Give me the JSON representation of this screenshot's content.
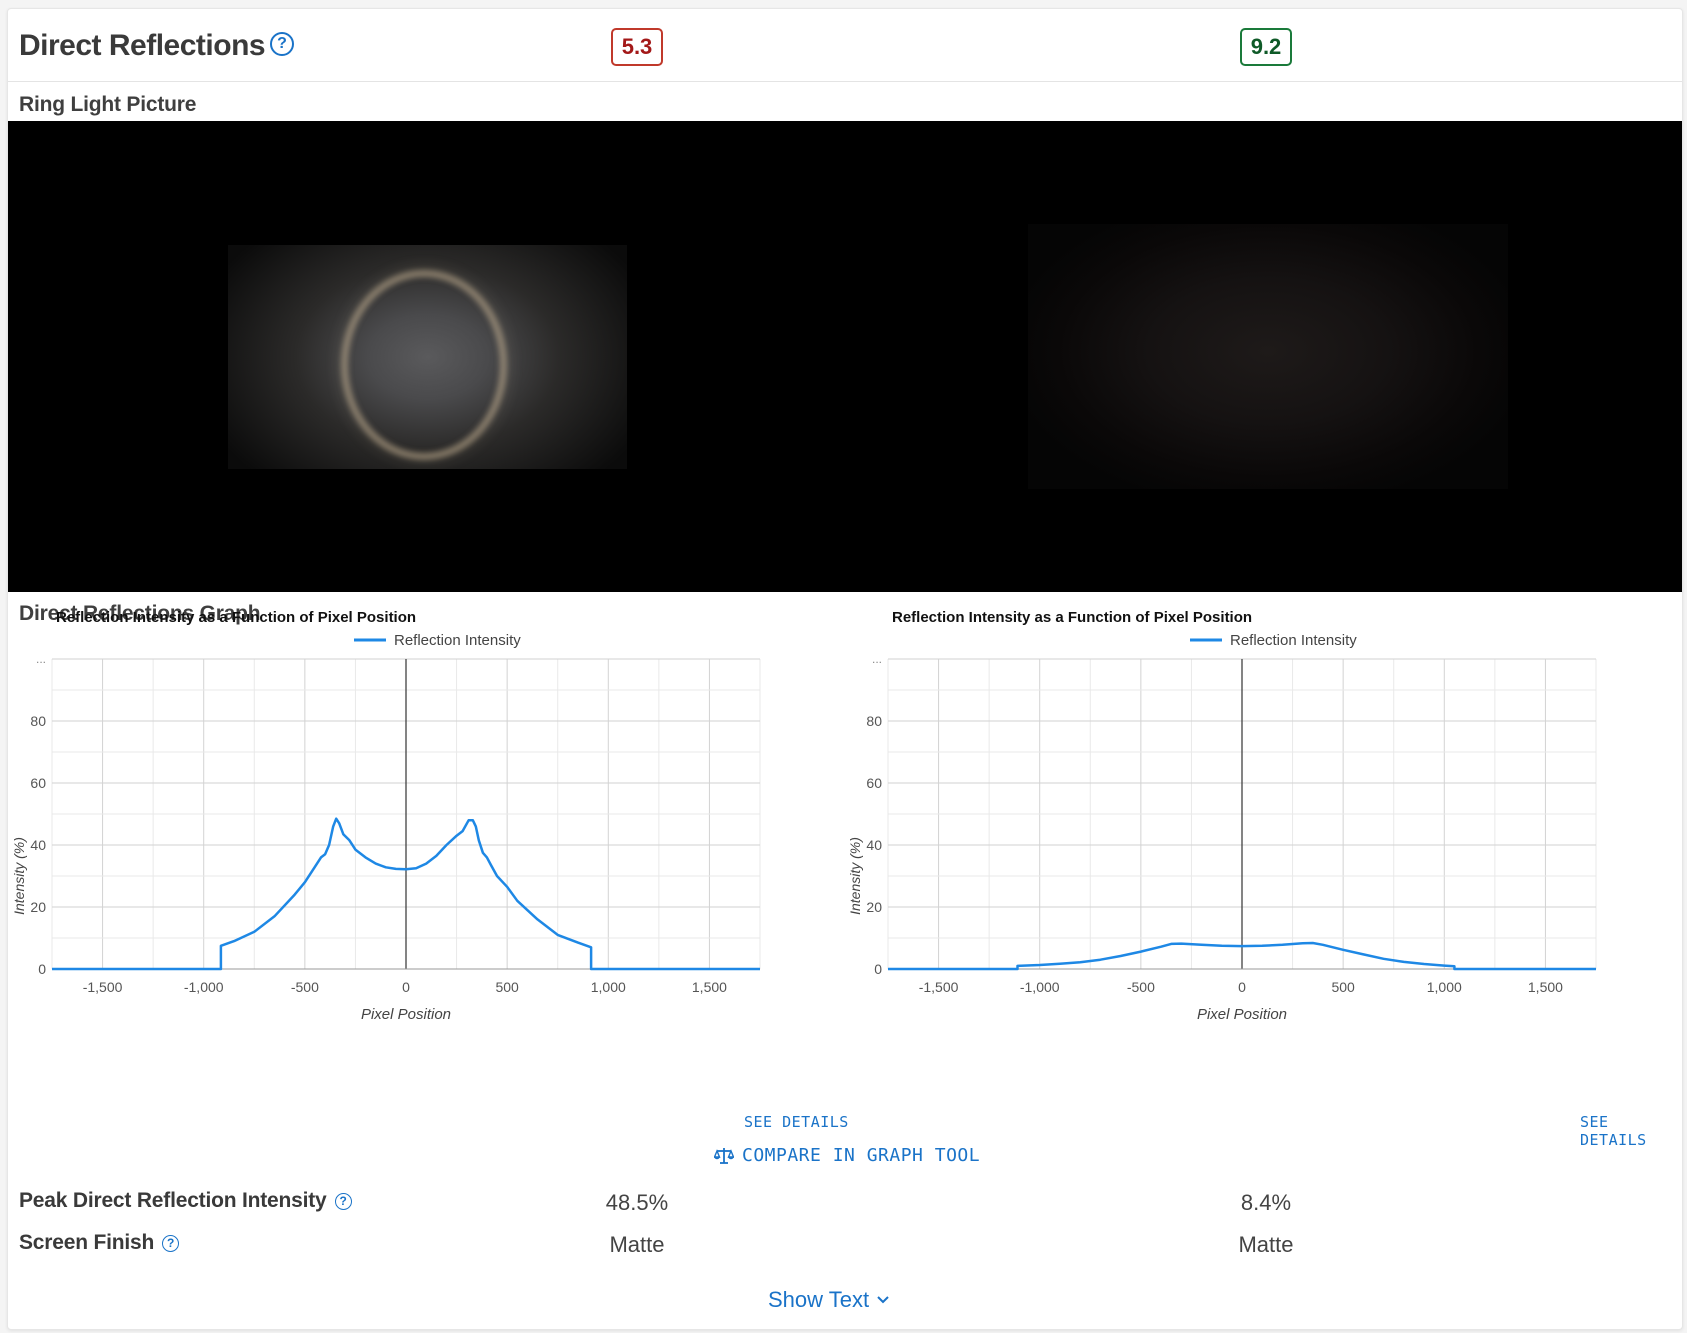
{
  "header": {
    "title": "Direct Reflections",
    "score_left": "5.3",
    "score_right": "9.2"
  },
  "sections": {
    "ring_light": "Ring Light Picture",
    "graph": "Direct Reflections Graph"
  },
  "help_glyph": "?",
  "colors": {
    "accent": "#1a73c8",
    "line": "#1e88e5",
    "score_bad": "#a31818",
    "score_good": "#0f5a28"
  },
  "chart_data": [
    {
      "type": "line",
      "title": "Reflection Intensity as a Function of Pixel Position",
      "xlabel": "Pixel Position",
      "ylabel": "Intensity (%)",
      "xlim": [
        -1750,
        1750
      ],
      "ylim": [
        0,
        100
      ],
      "x_ticks": [
        -1500,
        -1000,
        -500,
        0,
        500,
        1000,
        1500
      ],
      "x_tick_labels": [
        "-1,500",
        "-1,000",
        "-500",
        "0",
        "500",
        "1,000",
        "1,500"
      ],
      "y_ticks": [
        0,
        20,
        40,
        60,
        80
      ],
      "y_tick_labels": [
        "0",
        "20",
        "40",
        "60",
        "80"
      ],
      "y_top_label": "...",
      "grid": true,
      "legend": "top-center",
      "series": [
        {
          "name": "Reflection Intensity",
          "x": [
            -1750,
            -915,
            -915,
            -850,
            -750,
            -650,
            -550,
            -500,
            -450,
            -420,
            -400,
            -380,
            -360,
            -345,
            -330,
            -310,
            -280,
            -250,
            -200,
            -150,
            -100,
            -50,
            0,
            50,
            100,
            150,
            200,
            250,
            280,
            310,
            330,
            345,
            360,
            380,
            400,
            420,
            450,
            500,
            550,
            650,
            750,
            850,
            915,
            915,
            1750
          ],
          "y": [
            0,
            0,
            7.5,
            9,
            12,
            17,
            24,
            28,
            33,
            36,
            37,
            40,
            46,
            48.5,
            47,
            43.5,
            41.5,
            38.5,
            36,
            34,
            32.8,
            32.3,
            32.2,
            32.5,
            34,
            36.5,
            40,
            43,
            44.5,
            48,
            48,
            46,
            41.5,
            37.5,
            36,
            33.5,
            30,
            26.5,
            22,
            16,
            11,
            8.5,
            7,
            0,
            0
          ]
        }
      ]
    },
    {
      "type": "line",
      "title": "Reflection Intensity as a Function of Pixel Position",
      "xlabel": "Pixel Position",
      "ylabel": "Intensity (%)",
      "xlim": [
        -1750,
        1750
      ],
      "ylim": [
        0,
        100
      ],
      "x_ticks": [
        -1500,
        -1000,
        -500,
        0,
        500,
        1000,
        1500
      ],
      "x_tick_labels": [
        "-1,500",
        "-1,000",
        "-500",
        "0",
        "500",
        "1,000",
        "1,500"
      ],
      "y_ticks": [
        0,
        20,
        40,
        60,
        80
      ],
      "y_tick_labels": [
        "0",
        "20",
        "40",
        "60",
        "80"
      ],
      "y_top_label": "...",
      "grid": true,
      "legend": "top-center",
      "series": [
        {
          "name": "Reflection Intensity",
          "x": [
            -1750,
            -1110,
            -1110,
            -1000,
            -900,
            -800,
            -700,
            -600,
            -500,
            -400,
            -350,
            -300,
            -200,
            -100,
            0,
            100,
            200,
            300,
            350,
            400,
            500,
            600,
            700,
            800,
            900,
            1000,
            1050,
            1050,
            1750
          ],
          "y": [
            0,
            0,
            1,
            1.3,
            1.7,
            2.2,
            3,
            4.2,
            5.6,
            7.2,
            8.1,
            8.2,
            7.8,
            7.5,
            7.4,
            7.5,
            7.8,
            8.3,
            8.4,
            7.8,
            6.2,
            4.7,
            3.3,
            2.3,
            1.6,
            1.1,
            0.9,
            0,
            0
          ]
        }
      ]
    }
  ],
  "links": {
    "see_details": "SEE DETAILS",
    "compare": "COMPARE IN GRAPH TOOL",
    "show_text": "Show Text"
  },
  "metrics": [
    {
      "label": "Peak Direct Reflection Intensity",
      "left": "48.5%",
      "right": "8.4%"
    },
    {
      "label": "Screen Finish",
      "left": "Matte",
      "right": "Matte"
    }
  ]
}
